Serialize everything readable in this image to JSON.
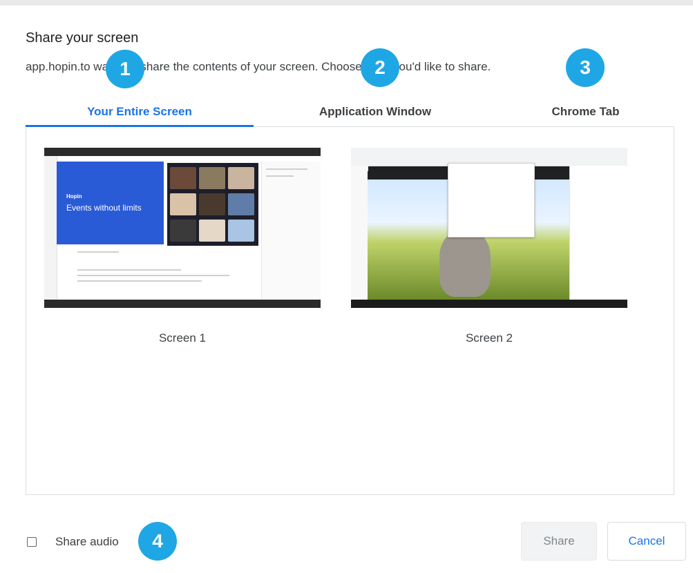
{
  "dialog": {
    "title": "Share your screen",
    "subtitle": "app.hopin.to wants to share the contents of your screen. Choose what you'd like to share."
  },
  "tabs": [
    {
      "label": "Your Entire Screen",
      "active": true
    },
    {
      "label": "Application Window",
      "active": false
    },
    {
      "label": "Chrome Tab",
      "active": false
    }
  ],
  "screens": [
    {
      "label": "Screen 1",
      "preview_text": "Events without limits",
      "preview_kicker": "Hopin"
    },
    {
      "label": "Screen 2"
    }
  ],
  "footer": {
    "share_audio_label": "Share audio",
    "share_audio_checked": false,
    "share_button": "Share",
    "cancel_button": "Cancel"
  },
  "callouts": [
    "1",
    "2",
    "3",
    "4"
  ],
  "colors": {
    "accent": "#1a73e8",
    "callout": "#1ea7e4",
    "preview_brand": "#2a5bd7"
  }
}
